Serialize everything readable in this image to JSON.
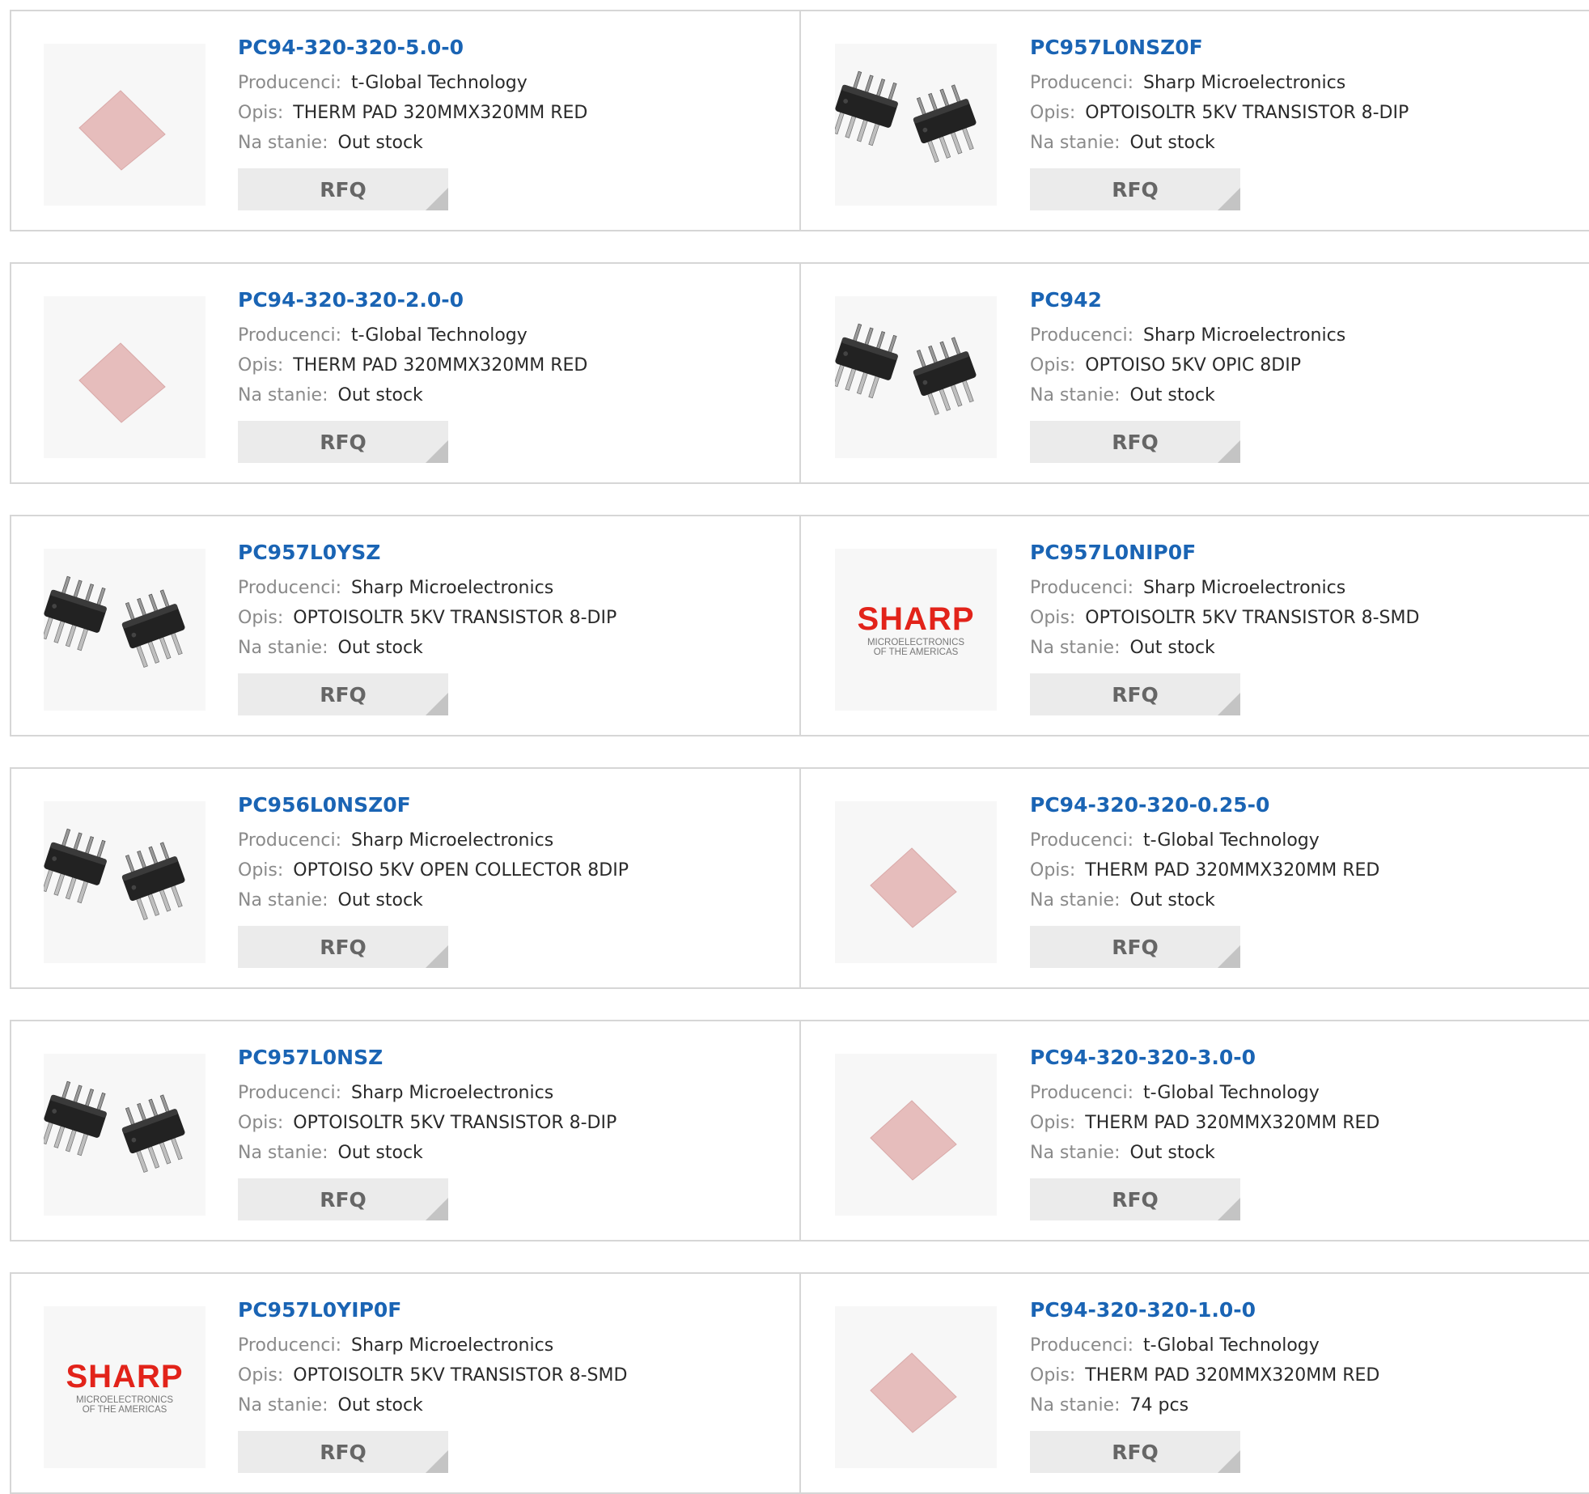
{
  "labels": {
    "manufacturer": "Producenci:",
    "description": "Opis:",
    "stock": "Na stanie:",
    "rfq": "RFQ"
  },
  "colors": {
    "part_link": "#1a64b4",
    "label": "#8a8a8a",
    "button_bg": "#ebebeb",
    "sharp_red": "#e2231a",
    "thermal_pad": "#e6bdbc"
  },
  "products": [
    {
      "part": "PC94-320-320-5.0-0",
      "manufacturer": "t-Global Technology",
      "description": "THERM PAD 320MMX320MM RED",
      "stock": "Out stock",
      "image": "thermal-pad"
    },
    {
      "part": "PC957L0NSZ0F",
      "manufacturer": "Sharp Microelectronics",
      "description": "OPTOISOLTR 5KV TRANSISTOR 8-DIP",
      "stock": "Out stock",
      "image": "dip-chip"
    },
    {
      "part": "PC94-320-320-2.0-0",
      "manufacturer": "t-Global Technology",
      "description": "THERM PAD 320MMX320MM RED",
      "stock": "Out stock",
      "image": "thermal-pad"
    },
    {
      "part": "PC942",
      "manufacturer": "Sharp Microelectronics",
      "description": "OPTOISO 5KV OPIC 8DIP",
      "stock": "Out stock",
      "image": "dip-chip"
    },
    {
      "part": "PC957L0YSZ",
      "manufacturer": "Sharp Microelectronics",
      "description": "OPTOISOLTR 5KV TRANSISTOR 8-DIP",
      "stock": "Out stock",
      "image": "dip-chip"
    },
    {
      "part": "PC957L0NIP0F",
      "manufacturer": "Sharp Microelectronics",
      "description": "OPTOISOLTR 5KV TRANSISTOR 8-SMD",
      "stock": "Out stock",
      "image": "sharp-logo"
    },
    {
      "part": "PC956L0NSZ0F",
      "manufacturer": "Sharp Microelectronics",
      "description": "OPTOISO 5KV OPEN COLLECTOR 8DIP",
      "stock": "Out stock",
      "image": "dip-chip"
    },
    {
      "part": "PC94-320-320-0.25-0",
      "manufacturer": "t-Global Technology",
      "description": "THERM PAD 320MMX320MM RED",
      "stock": "Out stock",
      "image": "thermal-pad"
    },
    {
      "part": "PC957L0NSZ",
      "manufacturer": "Sharp Microelectronics",
      "description": "OPTOISOLTR 5KV TRANSISTOR 8-DIP",
      "stock": "Out stock",
      "image": "dip-chip"
    },
    {
      "part": "PC94-320-320-3.0-0",
      "manufacturer": "t-Global Technology",
      "description": "THERM PAD 320MMX320MM RED",
      "stock": "Out stock",
      "image": "thermal-pad"
    },
    {
      "part": "PC957L0YIP0F",
      "manufacturer": "Sharp Microelectronics",
      "description": "OPTOISOLTR 5KV TRANSISTOR 8-SMD",
      "stock": "Out stock",
      "image": "sharp-logo"
    },
    {
      "part": "PC94-320-320-1.0-0",
      "manufacturer": "t-Global Technology",
      "description": "THERM PAD 320MMX320MM RED",
      "stock": "74 pcs",
      "image": "thermal-pad"
    }
  ],
  "sharp_logo": {
    "word": "SHARP",
    "line1": "MICROELECTRONICS",
    "line2": "OF THE AMERICAS"
  }
}
